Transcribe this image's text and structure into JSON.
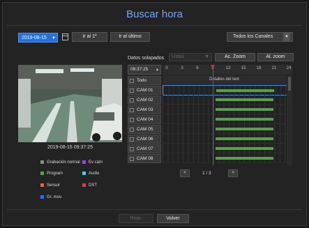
{
  "title": "Buscar hora",
  "date": {
    "value": "2019-08-15",
    "arrow": "▼"
  },
  "toolbar": {
    "first_label": "Ir al 1º",
    "last_label": "Ir al último"
  },
  "channel_select": {
    "value": "Todos los Canales",
    "arrow": "▼"
  },
  "overlap": {
    "label": "Datos solapados",
    "value": "Lista1",
    "arrow": "▼"
  },
  "zoom": {
    "in_label": "Ac. Zoom",
    "out_label": "Al. zoom"
  },
  "time_value": "09:37:25",
  "time_arrow": "▲",
  "ruler_ticks": [
    "0",
    "3",
    "6",
    "9",
    "12",
    "15",
    "18",
    "21",
    "24"
  ],
  "camera_timestamp": "2019-08-15 09:37:25",
  "legend": [
    {
      "label": "Grabación normal",
      "color": "#8a8a8a"
    },
    {
      "label": "Ev cám",
      "color": "#8a4fc9"
    },
    {
      "label": "Program",
      "color": "#58a14a"
    },
    {
      "label": "Audio",
      "color": "#5fc3d9"
    },
    {
      "label": "Sensor",
      "color": "#e06b2a"
    },
    {
      "label": "DST",
      "color": "#e03a3a"
    },
    {
      "label": "Gr. mov.",
      "color": "#2e6fd8"
    }
  ],
  "channel_header": "Todo",
  "detail_header": "Detalles del text",
  "channels": [
    "CAM 01",
    "CAM 02",
    "CAM 03",
    "CAM 04",
    "CAM 05",
    "CAM 06",
    "CAM 07",
    "CAM 08"
  ],
  "recording_hours": {
    "start": 9.6,
    "end": 20.9
  },
  "cursor_hour": 9.6,
  "pagination": {
    "prev": "<",
    "next": ">",
    "page": "1 / 3"
  },
  "footer": {
    "prev_label": "Repr.",
    "back_label": "Volver"
  },
  "colors": {
    "accent": "#2a6fd8",
    "recording": "#58a14a",
    "cursor": "#d83030"
  }
}
